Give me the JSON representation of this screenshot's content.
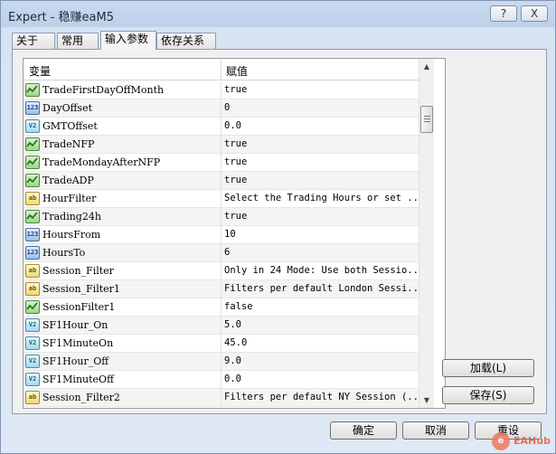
{
  "window": {
    "title": "Expert - 稳赚eaM5",
    "help_label": "?",
    "close_label": "X"
  },
  "tabs": [
    {
      "label": "关于"
    },
    {
      "label": "常用"
    },
    {
      "label": "输入参数",
      "active": true
    },
    {
      "label": "依存关系"
    }
  ],
  "grid": {
    "col_variable": "变量",
    "col_value": "赋值",
    "rows": [
      {
        "type": "bool",
        "icon": "bool-param-icon",
        "name": "TradeFirstDayOffMonth",
        "value": "true"
      },
      {
        "type": "int",
        "icon": "int-param-icon",
        "glyph": "123",
        "name": "DayOffset",
        "value": "0"
      },
      {
        "type": "dbl",
        "icon": "double-param-icon",
        "glyph": "V2",
        "name": "GMTOffset",
        "value": "0.0"
      },
      {
        "type": "bool",
        "icon": "bool-param-icon",
        "name": "TradeNFP",
        "value": "true"
      },
      {
        "type": "bool",
        "icon": "bool-param-icon",
        "name": "TradeMondayAfterNFP",
        "value": "true"
      },
      {
        "type": "bool",
        "icon": "bool-param-icon",
        "name": "TradeADP",
        "value": "true"
      },
      {
        "type": "str",
        "icon": "string-param-icon",
        "glyph": "ab",
        "name": "HourFilter",
        "value": "Select the Trading Hours or set ..."
      },
      {
        "type": "bool",
        "icon": "bool-param-icon",
        "name": "Trading24h",
        "value": "true"
      },
      {
        "type": "int",
        "icon": "int-param-icon",
        "glyph": "123",
        "name": "HoursFrom",
        "value": "10"
      },
      {
        "type": "int",
        "icon": "int-param-icon",
        "glyph": "123",
        "name": "HoursTo",
        "value": "6"
      },
      {
        "type": "str",
        "icon": "string-param-icon",
        "glyph": "ab",
        "name": "Session_Filter",
        "value": "Only in 24 Mode: Use both Sessio..."
      },
      {
        "type": "str",
        "icon": "string-param-icon",
        "glyph": "ab",
        "name": "Session_Filter1",
        "value": "Filters per default London Sessi..."
      },
      {
        "type": "bool",
        "icon": "bool-param-icon",
        "name": "SessionFilter1",
        "value": "false"
      },
      {
        "type": "dbl",
        "icon": "double-param-icon",
        "glyph": "V2",
        "name": "SF1Hour_On",
        "value": "5.0"
      },
      {
        "type": "dbl",
        "icon": "double-param-icon",
        "glyph": "V2",
        "name": "SF1MinuteOn",
        "value": "45.0"
      },
      {
        "type": "dbl",
        "icon": "double-param-icon",
        "glyph": "V2",
        "name": "SF1Hour_Off",
        "value": "9.0"
      },
      {
        "type": "dbl",
        "icon": "double-param-icon",
        "glyph": "V2",
        "name": "SF1MinuteOff",
        "value": "0.0"
      },
      {
        "type": "str",
        "icon": "string-param-icon",
        "glyph": "ab",
        "name": "Session_Filter2",
        "value": "Filters per default NY Session (..."
      }
    ]
  },
  "side_buttons": {
    "load_label": "加载(L)",
    "save_label": "保存(S)"
  },
  "footer": {
    "ok_label": "确定",
    "cancel_label": "取消",
    "reset_label": "重设"
  },
  "watermark": {
    "logo": "e",
    "text": "EAHub"
  }
}
